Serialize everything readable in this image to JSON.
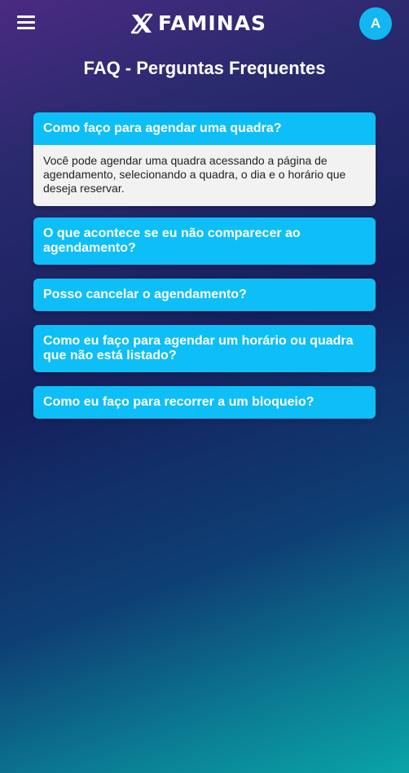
{
  "header": {
    "brand": "FAMINAS",
    "avatar_initial": "A"
  },
  "page": {
    "title": "FAQ - Perguntas Frequentes"
  },
  "faqs": [
    {
      "question": "Como faço para agendar uma quadra?",
      "answer": "Você pode agendar uma quadra acessando a página de agendamento, selecionando a quadra, o dia e o horário que deseja reservar.",
      "expanded": true
    },
    {
      "question": "O que acontece se eu não comparecer ao agendamento?",
      "expanded": false
    },
    {
      "question": "Posso cancelar o agendamento?",
      "expanded": false
    },
    {
      "question": "Como eu faço para agendar um horário ou quadra que não está listado?",
      "expanded": false
    },
    {
      "question": "Como eu faço para recorrer a um bloqueio?",
      "expanded": false
    }
  ],
  "colors": {
    "accent": "#0ebef7",
    "answer_bg": "#f2f2f2",
    "avatar_bg": "#12b7f1"
  },
  "icons": {
    "menu": "hamburger-menu-icon",
    "logo": "faminas-x-logo-icon"
  }
}
